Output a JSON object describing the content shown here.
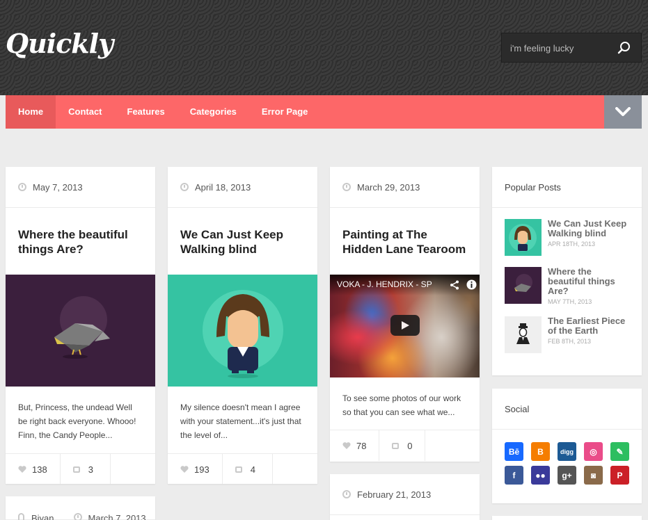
{
  "header": {
    "logo": "Quickly",
    "search_placeholder": "i'm feeling lucky"
  },
  "nav": {
    "items": [
      "Home",
      "Contact",
      "Features",
      "Categories",
      "Error Page"
    ],
    "active": "Home"
  },
  "posts": [
    {
      "date": "May 7, 2013",
      "title": "Where the beautiful things Are?",
      "excerpt": "But, Princess, the undead Well be right back everyone. Whooo! Finn, the Candy People...",
      "likes": "138",
      "comments": "3"
    },
    {
      "date": "April 18, 2013",
      "title": "We Can Just Keep Walking blind",
      "excerpt": "My silence doesn't mean I agree with your statement...it's just that the level of...",
      "likes": "193",
      "comments": "4"
    },
    {
      "date": "March 29, 2013",
      "title": "Painting at The Hidden Lane Tearoom",
      "video_title": "VOKA - J. HENDRIX - SP",
      "excerpt": "To see some photos of our work so that you can see what we...",
      "likes": "78",
      "comments": "0"
    },
    {
      "date": "February 21, 2013"
    },
    {
      "author": "Biyan",
      "date": "March 7, 2013"
    }
  ],
  "sidebar": {
    "popular_title": "Popular Posts",
    "popular": [
      {
        "title": "We Can Just Keep Walking blind",
        "date": "APR 18TH, 2013"
      },
      {
        "title": "Where the beautiful things Are?",
        "date": "MAY 7TH, 2013"
      },
      {
        "title": "The Earliest Piece of the Earth",
        "date": "FEB 8TH, 2013"
      }
    ],
    "social_title": "Social",
    "social": [
      {
        "name": "behance",
        "label": "Bē",
        "color": "#1769ff"
      },
      {
        "name": "blogger",
        "label": "B",
        "color": "#f57d00"
      },
      {
        "name": "digg",
        "label": "digg",
        "color": "#1d5a94"
      },
      {
        "name": "dribbble",
        "label": "◎",
        "color": "#ea4c89"
      },
      {
        "name": "evernote",
        "label": "✎",
        "color": "#2dbe60"
      },
      {
        "name": "facebook",
        "label": "f",
        "color": "#3b5998"
      },
      {
        "name": "flickr",
        "label": "●●",
        "color": "#3a3a9a"
      },
      {
        "name": "google-plus",
        "label": "g+",
        "color": "#555555"
      },
      {
        "name": "instagram",
        "label": "◙",
        "color": "#8a6a4a"
      },
      {
        "name": "pinterest",
        "label": "P",
        "color": "#cb2027"
      }
    ]
  },
  "colors": {
    "accent": "#fd6768",
    "accent_active": "#e85a5b",
    "nav_toggle": "#8a909a",
    "bird_bg": "#3b1f3d",
    "character_bg": "#35c3a2"
  }
}
